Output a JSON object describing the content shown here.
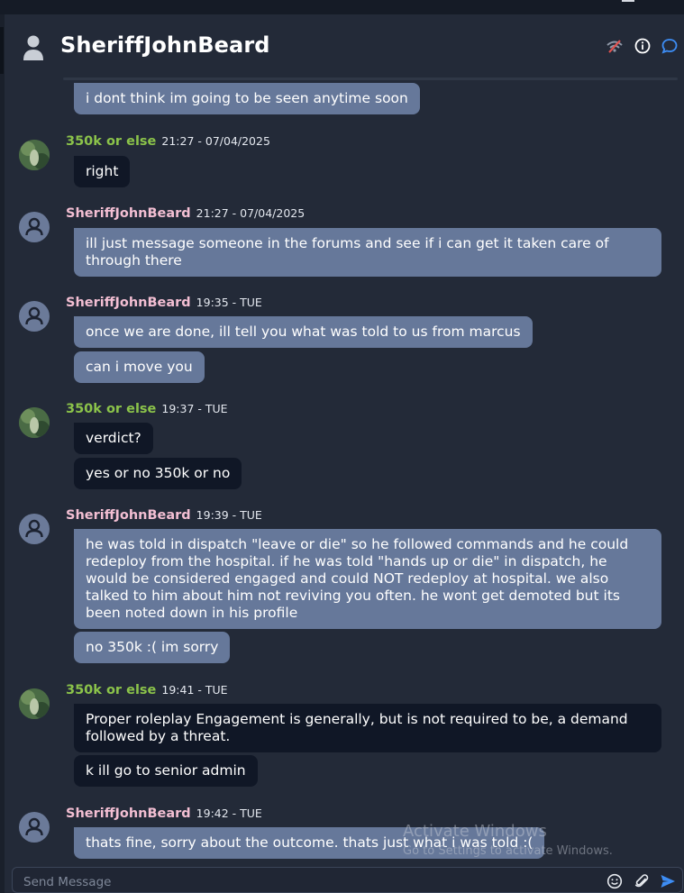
{
  "header": {
    "title": "SheriffJohnBeard",
    "icons": [
      "signal-off-icon",
      "info-icon",
      "chat-bubble-icon"
    ]
  },
  "colors": {
    "background": "#232a38",
    "bubble_sent": "#66789a",
    "bubble_received": "#101726",
    "name_sheriff": "#f3bfd3",
    "name_other": "#8bc34a",
    "accent_blue": "#3d8df5",
    "alert_red": "#e0524f"
  },
  "messages": [
    {
      "sender": "SheriffJohnBeard",
      "time": "",
      "lines": [
        "i dont think im going to be seen anytime soon"
      ]
    },
    {
      "sender": "350k or else",
      "time": "21:27 - 07/04/2025",
      "lines": [
        "right"
      ]
    },
    {
      "sender": "SheriffJohnBeard",
      "time": "21:27 - 07/04/2025",
      "lines": [
        "ill just message someone in the forums and see if i can get it taken care of through there"
      ]
    },
    {
      "sender": "SheriffJohnBeard",
      "time": "19:35 - TUE",
      "lines": [
        "once we are done, ill tell you what was told to us from marcus",
        "can i move you"
      ]
    },
    {
      "sender": "350k or else",
      "time": "19:37 - TUE",
      "lines": [
        "verdict?",
        "yes or no 350k or no"
      ]
    },
    {
      "sender": "SheriffJohnBeard",
      "time": "19:39 - TUE",
      "lines": [
        "he was told in dispatch \"leave or die\" so he followed commands and he could redeploy from the hospital. if he was told \"hands up or die\" in dispatch, he would be considered engaged and could NOT redeploy at hospital. we also talked to him about him not reviving you often. he wont get demoted but its been noted down in his profile",
        "no 350k :( im sorry"
      ]
    },
    {
      "sender": "350k or else",
      "time": "19:41 - TUE",
      "lines": [
        "Proper roleplay Engagement is generally, but is not required to be, a demand followed by a threat.",
        "k ill go to senior admin"
      ]
    },
    {
      "sender": "SheriffJohnBeard",
      "time": "19:42 - TUE",
      "lines": [
        "thats fine, sorry about the outcome. thats just what i was told :("
      ]
    }
  ],
  "watermark": {
    "line1": "Activate Windows",
    "line2": "Go to Settings to activate Windows."
  },
  "composer": {
    "placeholder": "Send Message",
    "icons": [
      "emoji-icon",
      "attachment-icon",
      "send-icon"
    ]
  }
}
